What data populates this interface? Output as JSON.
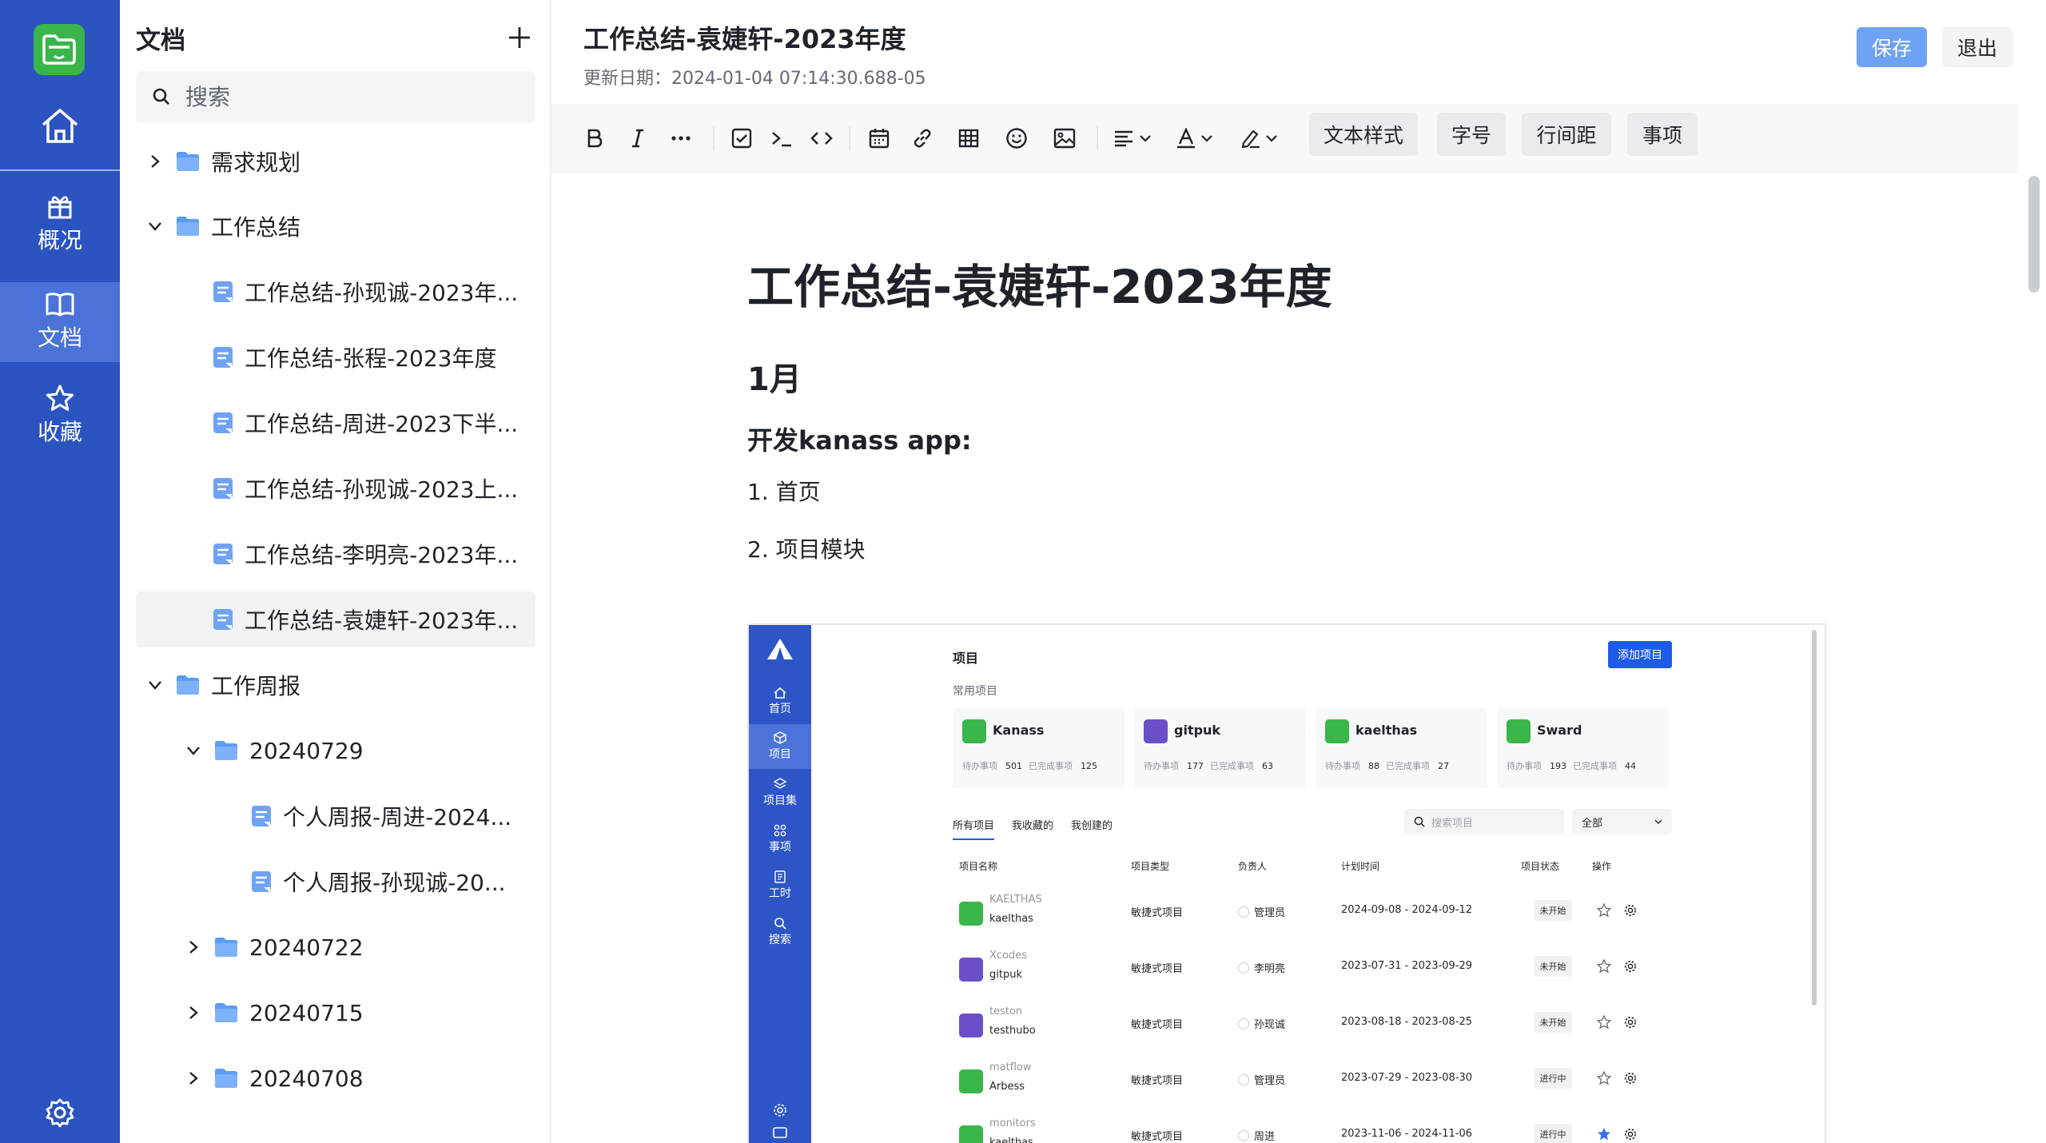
{
  "sidebar_rail": {
    "items": [
      {
        "label": "概况"
      },
      {
        "label": "文档"
      },
      {
        "label": "收藏"
      }
    ]
  },
  "tree": {
    "title": "文档",
    "search_placeholder": "搜索",
    "nodes": [
      {
        "label": "需求规划"
      },
      {
        "label": "工作总结"
      },
      {
        "label": "工作总结-孙现诚-2023年..."
      },
      {
        "label": "工作总结-张程-2023年度"
      },
      {
        "label": "工作总结-周进-2023下半..."
      },
      {
        "label": "工作总结-孙现诚-2023上..."
      },
      {
        "label": "工作总结-李明亮-2023年..."
      },
      {
        "label": "工作总结-袁婕轩-2023年..."
      },
      {
        "label": "工作周报"
      },
      {
        "label": "20240729"
      },
      {
        "label": "个人周报-周进-2024..."
      },
      {
        "label": "个人周报-孙现诚-20..."
      },
      {
        "label": "20240722"
      },
      {
        "label": "20240715"
      },
      {
        "label": "20240708"
      }
    ]
  },
  "editor": {
    "title": "工作总结-袁婕轩-2023年度",
    "updated": "更新日期：2024-01-04 07:14:30.688-05",
    "save_label": "保存",
    "exit_label": "退出",
    "toolbar_text_buttons": [
      "文本样式",
      "字号",
      "行间距",
      "事项"
    ]
  },
  "content": {
    "h1": "工作总结-袁婕轩-2023年度",
    "h2": "1月",
    "h3": "开发kanass app:",
    "items": [
      "1. 首页",
      "2. 项目模块"
    ]
  },
  "embedded": {
    "rail": [
      "首页",
      "项目",
      "项目集",
      "事项",
      "工时",
      "搜索"
    ],
    "title": "项目",
    "add_button": "添加项目",
    "subtitle": "常用项目",
    "cards": [
      {
        "name": "Kanass",
        "todo": "501",
        "done": "125",
        "color": "#3ab54a"
      },
      {
        "name": "gitpuk",
        "todo": "177",
        "done": "63",
        "color": "#6a4fc9"
      },
      {
        "name": "kaelthas",
        "todo": "88",
        "done": "27",
        "color": "#3ab54a"
      },
      {
        "name": "Sward",
        "todo": "193",
        "done": "44",
        "color": "#3ab54a"
      }
    ],
    "card_todo_label": "待办事项",
    "card_done_label": "已完成事项",
    "tabs": [
      "所有项目",
      "我收藏的",
      "我创建的"
    ],
    "search_placeholder": "搜索项目",
    "select_value": "全部",
    "columns": [
      "项目名称",
      "项目类型",
      "负责人",
      "计划时间",
      "项目状态",
      "操作"
    ],
    "rows": [
      {
        "key": "KAELTHAS",
        "name": "kaelthas",
        "type": "敏捷式项目",
        "owner": "管理员",
        "time": "2024-09-08 - 2024-09-12",
        "status": "未开始",
        "color": "#3ab54a",
        "starred": false
      },
      {
        "key": "Xcodes",
        "name": "gitpuk",
        "type": "敏捷式项目",
        "owner": "李明亮",
        "time": "2023-07-31 - 2023-09-29",
        "status": "未开始",
        "color": "#6a4fc9",
        "starred": false
      },
      {
        "key": "teston",
        "name": "testhubo",
        "type": "敏捷式项目",
        "owner": "孙现诚",
        "time": "2023-08-18 - 2023-08-25",
        "status": "未开始",
        "color": "#6a4fc9",
        "starred": false
      },
      {
        "key": "matflow",
        "name": "Arbess",
        "type": "敏捷式项目",
        "owner": "管理员",
        "time": "2023-07-29 - 2023-08-30",
        "status": "进行中",
        "color": "#3ab54a",
        "starred": false
      },
      {
        "key": "monitors",
        "name": "kaelthas",
        "type": "敏捷式项目",
        "owner": "周进",
        "time": "2023-11-06 - 2024-11-06",
        "status": "进行中",
        "color": "#3ab54a",
        "starred": true
      }
    ]
  }
}
